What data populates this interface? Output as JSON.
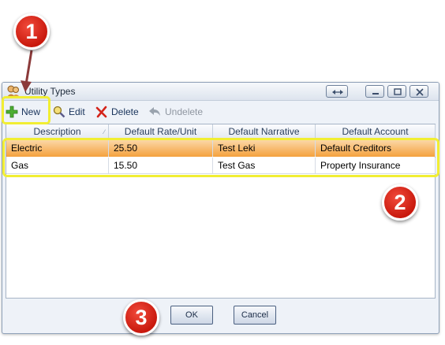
{
  "window": {
    "title": "Utility Types",
    "icon": "people-icon"
  },
  "toolbar": {
    "new_label": "New",
    "edit_label": "Edit",
    "delete_label": "Delete",
    "undelete_label": "Undelete"
  },
  "grid": {
    "columns": [
      "Description",
      "Default Rate/Unit",
      "Default Narrative",
      "Default Account"
    ],
    "rows": [
      {
        "description": "Electric",
        "rate": "25.50",
        "narrative": "Test Leki",
        "account": "Default Creditors",
        "selected": true
      },
      {
        "description": "Gas",
        "rate": "15.50",
        "narrative": "Test Gas",
        "account": "Property Insurance",
        "selected": false
      }
    ]
  },
  "footer": {
    "ok_label": "OK",
    "cancel_label": "Cancel"
  },
  "annotations": {
    "badge_1": "1",
    "badge_2": "2",
    "badge_3": "3",
    "badge_color": "#d8271a",
    "highlight_color": "#f1ee33",
    "arrow_color": "#8b3a3a"
  },
  "colors": {
    "selected_row_top": "#fbd7a6",
    "selected_row_bottom": "#f4a13e",
    "window_bg": "#eef2f8"
  }
}
